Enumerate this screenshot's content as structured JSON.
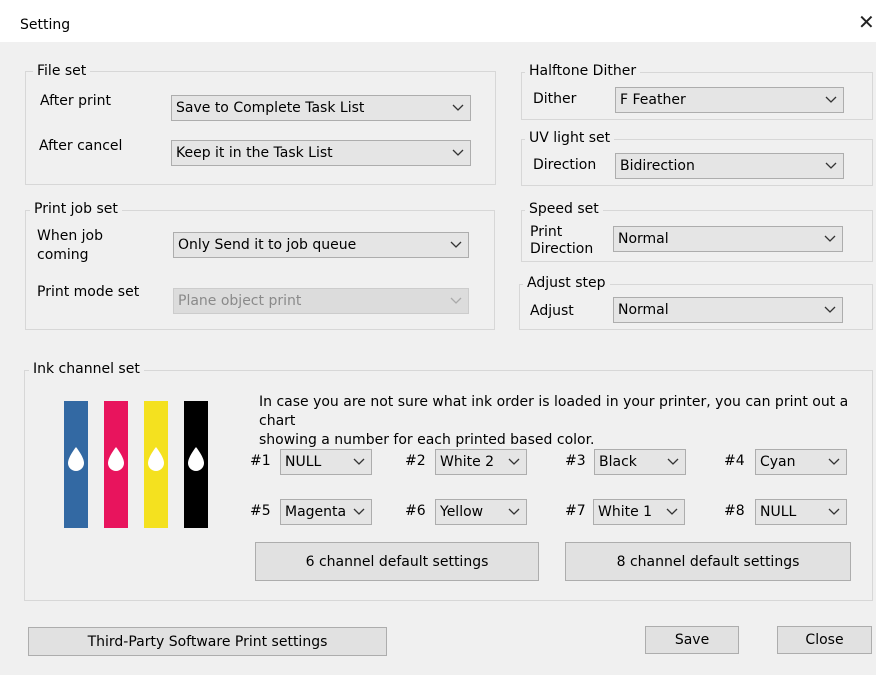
{
  "window": {
    "title": "Setting",
    "close_glyph": "✕"
  },
  "file_set": {
    "title": "File set",
    "after_print_label": "After print",
    "after_print_value": "Save to Complete Task List",
    "after_cancel_label": "After cancel",
    "after_cancel_value": "Keep it in the Task List"
  },
  "print_job_set": {
    "title": "Print job set",
    "when_job_label_1": "When job",
    "when_job_label_2": "coming",
    "when_job_value": "Only Send it to job queue",
    "print_mode_label": "Print mode set",
    "print_mode_value": "Plane object print"
  },
  "halftone": {
    "title": "Halftone Dither",
    "dither_label": "Dither",
    "dither_value": "F Feather"
  },
  "uv_light": {
    "title": "UV light set",
    "direction_label": "Direction",
    "direction_value": "Bidirection"
  },
  "speed": {
    "title": "Speed set",
    "print_label": "Print",
    "direction_label": "Direction",
    "value": "Normal"
  },
  "adjust_step": {
    "title": "Adjust step",
    "adjust_label": "Adjust",
    "value": "Normal"
  },
  "ink": {
    "title": "Ink channel set",
    "info_line1": "In case you are not sure what ink order is loaded in your printer, you can print out a chart",
    "info_line2": "showing a number for each printed based color.",
    "tube_colors": [
      "#3369a3",
      "#e8145d",
      "#f4e11f",
      "#000000"
    ],
    "channels": [
      {
        "num": "#1",
        "value": "NULL"
      },
      {
        "num": "#2",
        "value": "White 2"
      },
      {
        "num": "#3",
        "value": "Black"
      },
      {
        "num": "#4",
        "value": "Cyan"
      },
      {
        "num": "#5",
        "value": "Magenta"
      },
      {
        "num": "#6",
        "value": "Yellow"
      },
      {
        "num": "#7",
        "value": "White 1"
      },
      {
        "num": "#8",
        "value": "NULL"
      }
    ],
    "btn6": "6 channel default settings",
    "btn8": "8 channel default settings"
  },
  "footer": {
    "third_party": "Third-Party Software Print settings",
    "save": "Save",
    "close": "Close"
  }
}
